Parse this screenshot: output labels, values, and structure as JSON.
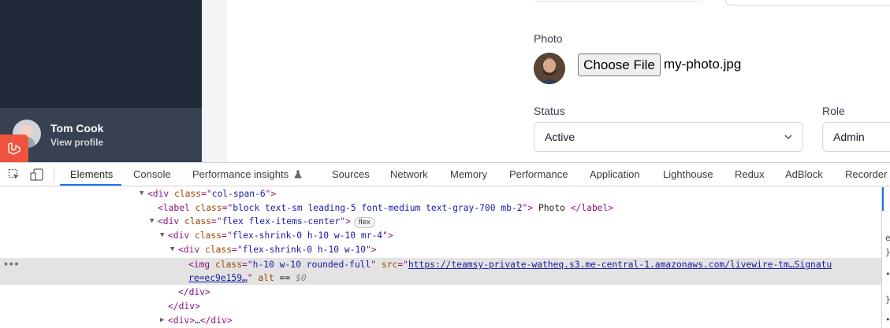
{
  "app": {
    "user": {
      "name": "Tom Cook",
      "profile_link": "View profile"
    },
    "form": {
      "photo_label": "Photo",
      "file_button": "Choose File",
      "file_name": "my-photo.jpg",
      "status_label": "Status",
      "status_value": "Active",
      "role_label": "Role",
      "role_value": "Admin"
    }
  },
  "devtools": {
    "tabs": [
      {
        "label": "Elements",
        "active": true
      },
      {
        "label": "Console"
      },
      {
        "label": "Performance insights"
      },
      {
        "label": "Sources"
      },
      {
        "label": "Network"
      },
      {
        "label": "Memory"
      },
      {
        "label": "Performance"
      },
      {
        "label": "Application"
      },
      {
        "label": "Lighthouse"
      },
      {
        "label": "Redux"
      },
      {
        "label": "AdBlock"
      },
      {
        "label": "Recorder"
      }
    ],
    "dom": {
      "l1_class": "col-span-6",
      "l2_class": "block text-sm leading-5 font-medium text-gray-700 mb-2",
      "l2_text": " Photo ",
      "l3_class": "flex flex-items-center",
      "l3_badge": "flex",
      "l4_class": "flex-shrink-0 h-10 w-10 mr-4",
      "l5_class": "flex-shrink-0 h-10 w-10",
      "l6_class": "h-10 w-10 rounded-full",
      "l6_src_part1": "https://teamsy-private-watheq.s3.me-central-1.amazonaws.com/livewire-tm…Signatu",
      "l6_src_part2": "re=ec9e159…",
      "l6_eq": " == ",
      "l6_ref": "$0",
      "l9_ellipsis": "…",
      "dots": "•••"
    },
    "side_pane_chars": [
      "e",
      "}",
      "•",
      "}",
      "•"
    ]
  }
}
